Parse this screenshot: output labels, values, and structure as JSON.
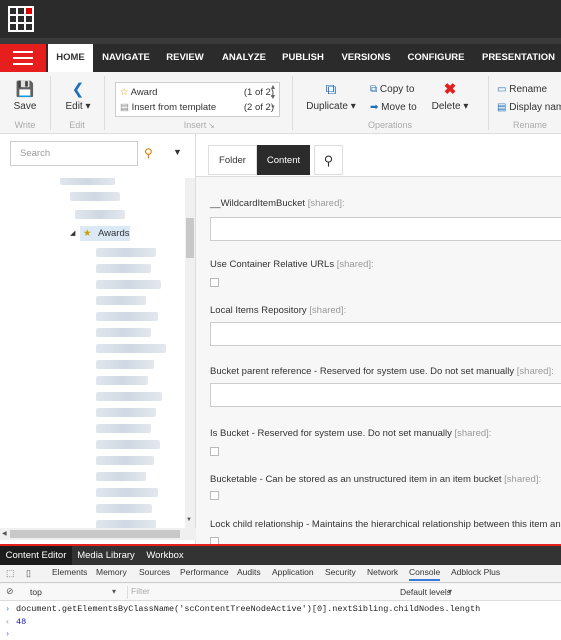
{
  "ribbon_tabs": [
    "HOME",
    "NAVIGATE",
    "REVIEW",
    "ANALYZE",
    "PUBLISH",
    "VERSIONS",
    "CONFIGURE",
    "PRESENTATION"
  ],
  "ribbon": {
    "save": "Save",
    "edit": "Edit",
    "write_group": "Write",
    "edit_group": "Edit",
    "insert_items": [
      {
        "label": "Award",
        "count": "(1 of 2)"
      },
      {
        "label": "Insert from template",
        "count": "(2 of 2)"
      }
    ],
    "insert_group": "Insert",
    "duplicate": "Duplicate",
    "copy_to": "Copy to",
    "move_to": "Move to",
    "delete": "Delete",
    "operations_group": "Operations",
    "rename": "Rename",
    "display_name": "Display nam",
    "rename_group": "Rename"
  },
  "search": {
    "placeholder": "Search"
  },
  "tree": {
    "selected_item": "Awards"
  },
  "editor_tabs": [
    "Folder",
    "Content"
  ],
  "fields": [
    {
      "label": "__WildcardItemBucket",
      "shared": "[shared]:"
    },
    {
      "label": "Use Container Relative URLs",
      "shared": "[shared]:"
    },
    {
      "label": "Local Items Repository",
      "shared": "[shared]:"
    },
    {
      "label": "Bucket parent reference - Reserved for system use. Do not set manually",
      "shared": "[shared]:"
    },
    {
      "label": "Is Bucket - Reserved for system use. Do not set manually",
      "shared": "[shared]:"
    },
    {
      "label": "Bucketable - Can be stored as an unstructured item in an item bucket",
      "shared": "[shared]:"
    },
    {
      "label": "Lock child relationship - Maintains the hierarchical relationship between this item and its c",
      "shared": ""
    }
  ],
  "bottom_tabs": [
    "Content Editor",
    "Media Library",
    "Workbox"
  ],
  "devtools": {
    "tabs": [
      "Elements",
      "Memory",
      "Sources",
      "Performance",
      "Audits",
      "Application",
      "Security",
      "Network",
      "Console",
      "Adblock Plus"
    ],
    "context": "top",
    "filter_placeholder": "Filter",
    "levels": "Default levels",
    "command": "document.getElementsByClassName('scContentTreeNodeActive')[0].nextSibling.childNodes.length",
    "result": "48"
  }
}
